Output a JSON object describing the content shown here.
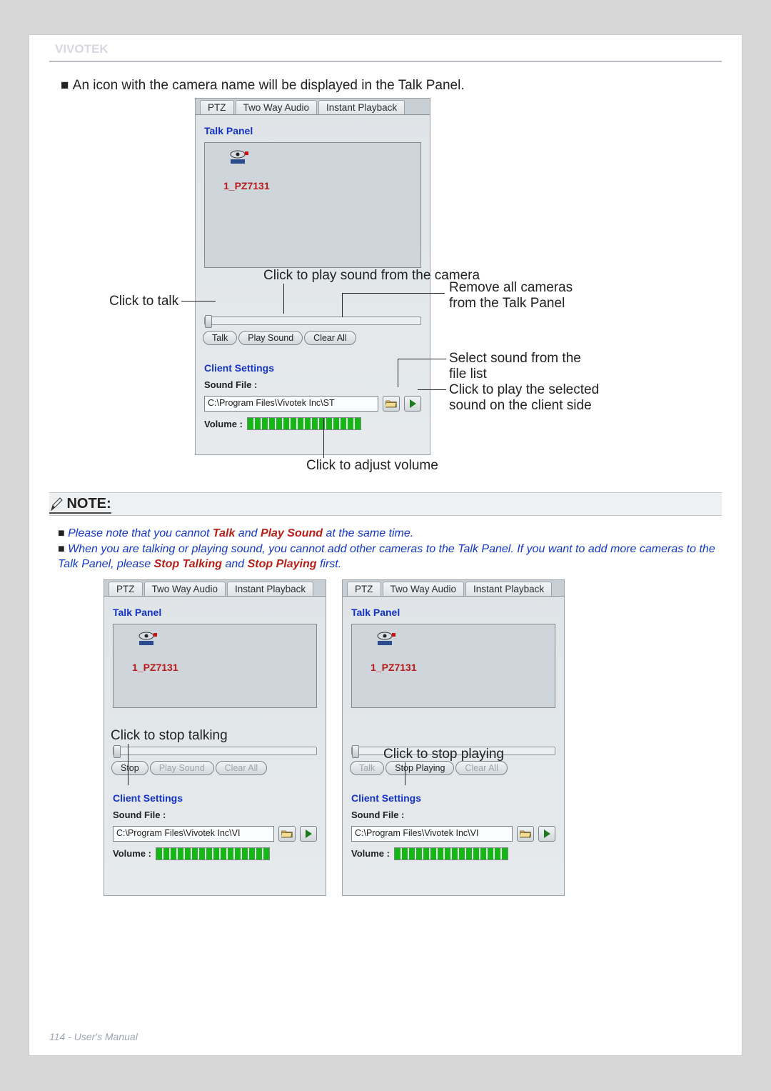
{
  "brand": "VIVOTEK",
  "intro_line": "An icon with the camera name will be displayed in the Talk Panel.",
  "tabs": {
    "ptz": "PTZ",
    "audio": "Two Way Audio",
    "playback": "Instant Playback"
  },
  "talk_panel_title": "Talk Panel",
  "camera_name": "1_PZ7131",
  "buttons": {
    "talk": "Talk",
    "play_sound": "Play Sound",
    "clear_all": "Clear All",
    "stop": "Stop",
    "stop_playing": "Stop Playing"
  },
  "client_settings_title": "Client Settings",
  "sound_file_label": "Sound File :",
  "sound_file_path_main": "C:\\Program Files\\Vivotek Inc\\ST",
  "sound_file_path_small": "C:\\Program Files\\Vivotek Inc\\VI",
  "volume_label": "Volume :",
  "callouts": {
    "click_to_talk": "Click to talk",
    "play_sound_camera": "Click to play sound from the camera",
    "remove_all_1": "Remove all cameras",
    "remove_all_2": "from the Talk Panel",
    "select_sound_1": "Select sound from the",
    "select_sound_2": "file list",
    "play_selected_1": "Click to play the selected",
    "play_selected_2": "sound on the client side",
    "adjust_volume": "Click to adjust volume",
    "stop_talking": "Click to stop talking",
    "stop_playing": "Click to stop playing"
  },
  "note_title": "NOTE:",
  "note1_pre": "Please note that you cannot ",
  "note1_talk": "Talk",
  "note1_and": " and ",
  "note1_play": "Play Sound",
  "note1_post": " at the same time.",
  "note2_pre": "When you are talking or playing sound, you cannot add other cameras to the Talk Panel. If you want to add more cameras to the Talk Panel, please ",
  "note2_stop_talk": "Stop Talking",
  "note2_and": " and ",
  "note2_stop_play": "Stop Playing",
  "note2_post": " first.",
  "footer": "114 - User's Manual"
}
